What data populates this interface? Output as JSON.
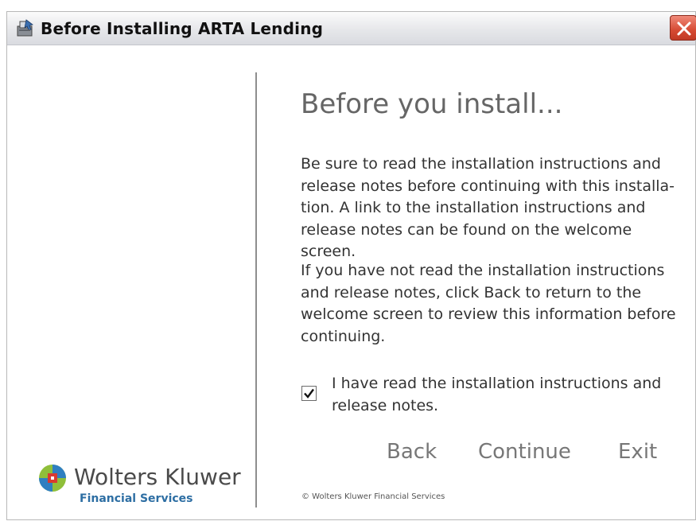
{
  "window": {
    "title": "Before Installing ARTA Lending",
    "icons": {
      "app": "installer-app-icon",
      "close": "close-icon"
    },
    "close_color": "#d64a33"
  },
  "main": {
    "heading": "Before you install...",
    "paragraph1": "Be sure to read the installation instructions and\nrelease notes before continuing with this installa-\ntion.  A link to the installation instructions and\nrelease notes can be found on the welcome screen.",
    "paragraph2": "If you have not read the installation instructions\nand release notes, click Back to return to the\nwelcome screen to review this information before\ncontinuing.",
    "checkbox": {
      "checked": true,
      "label": "I have read the installation instructions and\nrelease notes."
    }
  },
  "buttons": {
    "back": "Back",
    "continue": "Continue",
    "exit": "Exit"
  },
  "footer": {
    "copyright": "© Wolters Kluwer Financial Services"
  },
  "brand": {
    "name": "Wolters Kluwer",
    "subtitle": "Financial Services",
    "logo_icon": "wolters-kluwer-logo-icon",
    "subtitle_color": "#2d6ea3"
  }
}
